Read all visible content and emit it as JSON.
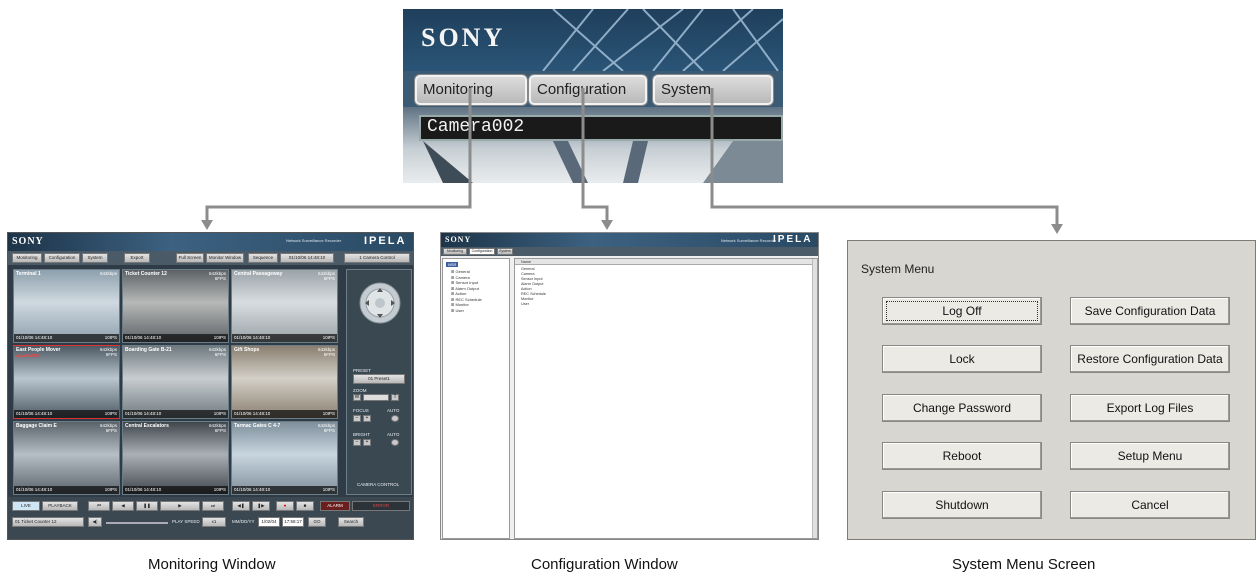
{
  "zoom_header": {
    "brand": "SONY",
    "tabs": [
      "Monitoring",
      "Configuration",
      "System"
    ],
    "camera_label": "Camera002"
  },
  "monitoring_window": {
    "brand": "SONY",
    "product": "Network Surveillance Recorder",
    "series_logo": "IPELA",
    "toolbar": {
      "monitoring": "Monitoring",
      "configuration": "Configuration",
      "system": "System",
      "export": "Export",
      "full_screen": "Full Screen",
      "monitor_window": "Monitor Window",
      "sequence": "Sequence",
      "datetime": "01/10/06 14:48:10",
      "camera_control": "1 Camera Control"
    },
    "cameras": [
      {
        "name": "Terminal 1",
        "bitrate": "642kbps",
        "fps": "",
        "alarm": "",
        "stamp": "01/10/06 14:48:10",
        "ips": "10IPS"
      },
      {
        "name": "Ticket Counter 12",
        "bitrate": "642kbps",
        "fps": "6FPS",
        "alarm": "",
        "stamp": "01/10/06 14:48:10",
        "ips": "10IPS"
      },
      {
        "name": "Central Passageway",
        "bitrate": "642kbps",
        "fps": "6FPS",
        "alarm": "",
        "stamp": "01/10/06 14:48:10",
        "ips": "10IPS"
      },
      {
        "name": "East People Mover",
        "bitrate": "642kbps",
        "fps": "6FPS",
        "alarm": "ALARMING",
        "stamp": "01/10/06 14:48:10",
        "ips": "10IPS"
      },
      {
        "name": "Boarding Gate B-21",
        "bitrate": "642kbps",
        "fps": "6FPS",
        "alarm": "",
        "stamp": "01/10/06 14:48:10",
        "ips": "10IPS"
      },
      {
        "name": "Gift Shops",
        "bitrate": "642kbps",
        "fps": "6FPS",
        "alarm": "",
        "stamp": "01/10/06 14:48:10",
        "ips": "10IPS"
      },
      {
        "name": "Baggage Claim E",
        "bitrate": "642kbps",
        "fps": "6FPS",
        "alarm": "",
        "stamp": "01/10/06 14:48:10",
        "ips": "10IPS"
      },
      {
        "name": "Central Escalators",
        "bitrate": "642kbps",
        "fps": "6FPS",
        "alarm": "",
        "stamp": "01/10/06 14:48:10",
        "ips": "10IPS"
      },
      {
        "name": "Tarmac Gates C 4-7",
        "bitrate": "642kbps",
        "fps": "6FPS",
        "alarm": "",
        "stamp": "01/10/06 14:48:10",
        "ips": "10IPS"
      }
    ],
    "camera_control": {
      "preset_label": "PRESET",
      "preset_value": "01 Preset1",
      "zoom_label": "ZOOM",
      "zoom_w": "W",
      "zoom_t": "T",
      "focus_label": "FOCUS",
      "auto_label": "AUTO",
      "bright_label": "BRIGHT",
      "panel_title": "CAMERA CONTROL"
    },
    "bottom": {
      "live": "LIVE",
      "playback": "PLAYBACK",
      "alarm": "ALARM",
      "error": "ERROR",
      "camera_select": "01 Ticket Counter 12",
      "play_speed_label": "PLAY SPEED",
      "play_speed_value": "x1",
      "date_format": "MM/DD/YY",
      "date_value": "1/02/04",
      "time_value": "17:58:17",
      "go": "GO",
      "search": "Search"
    }
  },
  "configuration_window": {
    "brand": "SONY",
    "product": "Network Surveillance Recorder",
    "series_logo": "IPELA",
    "tabs": [
      "Monitoring",
      "Configuration",
      "System"
    ],
    "tree_root": "NSR",
    "tree_items": [
      "General",
      "Camera",
      "Sensor Input",
      "Alarm Output",
      "Action",
      "REC Schedule",
      "Monitor",
      "User"
    ],
    "list_header": "Name",
    "list_items": [
      "General",
      "Camera",
      "Sensor Input",
      "Alarm Output",
      "Action",
      "REC Schedule",
      "Monitor",
      "User"
    ]
  },
  "system_menu": {
    "title": "System Menu",
    "left_buttons": [
      "Log Off",
      "Lock",
      "Change Password",
      "Reboot",
      "Shutdown"
    ],
    "right_buttons": [
      "Save Configuration Data",
      "Restore Configuration Data",
      "Export Log Files",
      "Setup Menu",
      "Cancel"
    ]
  },
  "captions": {
    "monitoring": "Monitoring Window",
    "configuration": "Configuration Window",
    "system": "System Menu Screen"
  },
  "colors": {
    "arrow": "#8c8c8c",
    "header_blue": "#2a5476",
    "system_bg": "#d8d6d0",
    "alarm_red": "#ff3b3b"
  }
}
